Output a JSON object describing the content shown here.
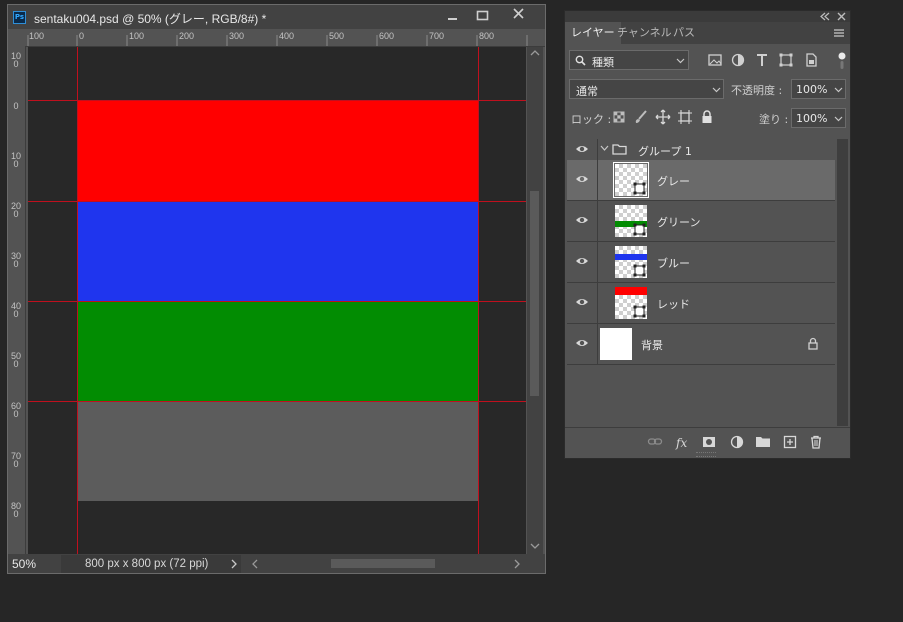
{
  "document": {
    "title": "sentaku004.psd @ 50% (グレー, RGB/8#) *",
    "app_icon": "Ps",
    "ruler_top_labels": [
      "100",
      "0",
      "100",
      "200",
      "300",
      "400",
      "500",
      "600",
      "700",
      "800"
    ],
    "ruler_left_labels": [
      "100",
      "0",
      "100",
      "200",
      "300",
      "400",
      "500",
      "600",
      "700",
      "800"
    ],
    "zoom": "50%",
    "doc_info": "800 px x 800 px (72 ppi)",
    "layer_colors": {
      "red": "#ff0000",
      "blue": "#1f35ee",
      "green": "#028c02",
      "gray": "#5c5c5c"
    },
    "guide_color": "#c0101e"
  },
  "layers_panel": {
    "tabs": [
      "レイヤー",
      "チャンネル",
      "パス"
    ],
    "active_tab": "レイヤー",
    "filter_kind": "種類",
    "blend_mode": "通常",
    "opacity_label": "不透明度 :",
    "opacity_value": "100%",
    "lock_label": "ロック :",
    "fill_label": "塗り :",
    "fill_value": "100%",
    "group": {
      "name": "グループ 1"
    },
    "layers": [
      {
        "name": "グレー",
        "selected": true,
        "color": "#5c5c5c"
      },
      {
        "name": "グリーン",
        "selected": false,
        "color": "#028c02"
      },
      {
        "name": "ブルー",
        "selected": false,
        "color": "#1f35ee"
      },
      {
        "name": "レッド",
        "selected": false,
        "color": "#ff0000"
      }
    ],
    "background": {
      "name": "背景",
      "locked": true
    },
    "footer_icons": [
      "link-icon",
      "fx-icon",
      "mask-icon",
      "adjustment-icon",
      "folder-icon",
      "new-layer-icon",
      "trash-icon"
    ]
  }
}
